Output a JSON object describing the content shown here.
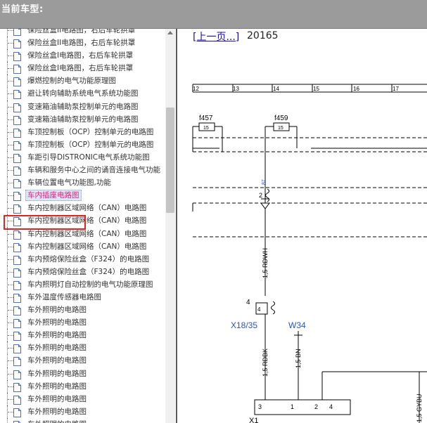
{
  "header": {
    "title": "当前车型:"
  },
  "tree": {
    "items": [
      {
        "label": "保险丝盒II电路图，右后车轮拱罩"
      },
      {
        "label": "保险丝盒II电路图，右后车轮拱罩"
      },
      {
        "label": "保险丝盒I电路图，右后车轮拱罩"
      },
      {
        "label": "保险丝盒I电路图，右后车轮拱罩"
      },
      {
        "label": "爆燃控制的电气功能原理图"
      },
      {
        "label": "避让转向辅助系统电气系统功能图"
      },
      {
        "label": "变速箱油辅助泵控制单元的电路图"
      },
      {
        "label": "变速箱油辅助泵控制单元的电路图"
      },
      {
        "label": "车顶控制板（OCP）控制单元的电路图"
      },
      {
        "label": "车顶控制板（OCP）控制单元的电路图"
      },
      {
        "label": "车距引导DISTRONIC电气系统功能图"
      },
      {
        "label": "车辆和服务中心之间的诵音连接电气功能"
      },
      {
        "label": "车辆位置电气功能图,功能"
      },
      {
        "label": "车内插座电路图"
      },
      {
        "label": "车内控制器区域网络（CAN）电路图"
      },
      {
        "label": "车内控制器区域网络（CAN）电路图"
      },
      {
        "label": "车内控制器区域网络（CAN）电路图"
      },
      {
        "label": "车内控制器区域网络（CAN）电路图"
      },
      {
        "label": "车内预熔保险丝盒（F324）的电路图"
      },
      {
        "label": "车内预熔保险丝盒（F324）的电路图"
      },
      {
        "label": "车内照明灯自动控制的电气功能原理图"
      },
      {
        "label": "车外温度传感器电路图"
      },
      {
        "label": "车外照明的电路图"
      },
      {
        "label": "车外照明的电路图"
      },
      {
        "label": "车外照明的电路图"
      },
      {
        "label": "车外照明的电路图"
      },
      {
        "label": "车外照明的电路图"
      },
      {
        "label": "车外照明的电路图"
      },
      {
        "label": "车外照明的电路图"
      },
      {
        "label": "车外照明的电路图"
      },
      {
        "label": "车外照明的电路图"
      },
      {
        "label": "车外照明的电路图"
      },
      {
        "label": "车外照明的电路图"
      }
    ],
    "selected_index": 13
  },
  "viewer": {
    "prev_link": "[上一页...]",
    "doc_number": "20165",
    "ruler": [
      "12",
      "13",
      "14",
      "15",
      "16",
      "17"
    ],
    "fuses": [
      {
        "name": "f457",
        "rating": "15"
      },
      {
        "name": "f459",
        "rating": "15"
      }
    ],
    "pin_87": "87",
    "pin_2": "2",
    "wire_top": "1,5 RDWH",
    "pin_4": "4",
    "pin_4b": "4",
    "conn_x18": "X18/35",
    "conn_w34": "W34",
    "wire_rdbk": "1,5 RDBK",
    "wire_bn": "1,5 BN",
    "wire_gybu": "1,5 GYBU",
    "plug_pins": [
      "3",
      "1",
      "2",
      "4"
    ],
    "bottom_label": "X1"
  }
}
